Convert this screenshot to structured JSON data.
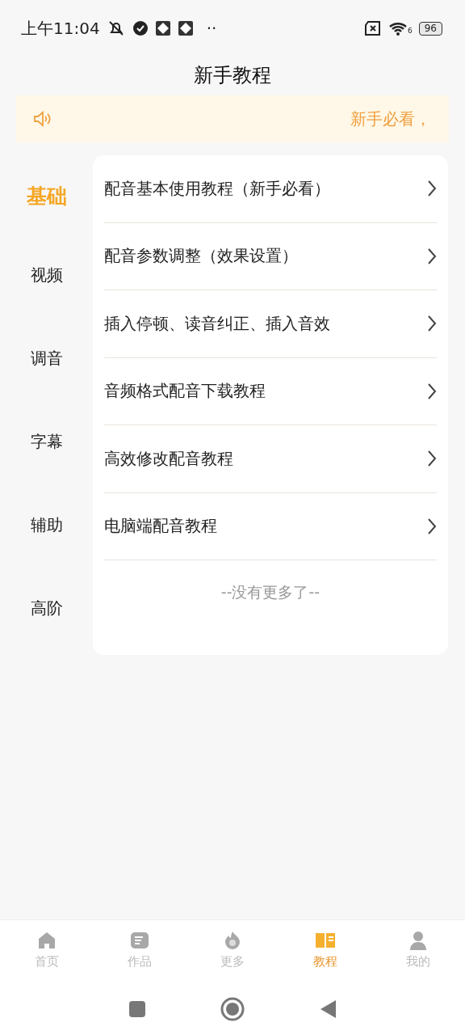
{
  "status_bar": {
    "time": "上午11:04",
    "more": "··",
    "wifi_label": "6",
    "battery": "96"
  },
  "header": {
    "title": "新手教程"
  },
  "notice": {
    "text": "新手必看，"
  },
  "categories": [
    {
      "label": "基础",
      "selected": true
    },
    {
      "label": "视频",
      "selected": false
    },
    {
      "label": "调音",
      "selected": false
    },
    {
      "label": "字幕",
      "selected": false
    },
    {
      "label": "辅助",
      "selected": false
    },
    {
      "label": "高阶",
      "selected": false
    }
  ],
  "tutorials": [
    "配音基本使用教程（新手必看）",
    "配音参数调整（效果设置）",
    "插入停顿、读音纠正、插入音效",
    "音频格式配音下载教程",
    "高效修改配音教程",
    "电脑端配音教程"
  ],
  "list_end": "--没有更多了--",
  "bottom_nav": [
    {
      "label": "首页",
      "kind": "home",
      "selected": false
    },
    {
      "label": "作品",
      "kind": "works",
      "selected": false
    },
    {
      "label": "更多",
      "kind": "more",
      "selected": false
    },
    {
      "label": "教程",
      "kind": "tutorial",
      "selected": true
    },
    {
      "label": "我的",
      "kind": "me",
      "selected": false
    }
  ]
}
